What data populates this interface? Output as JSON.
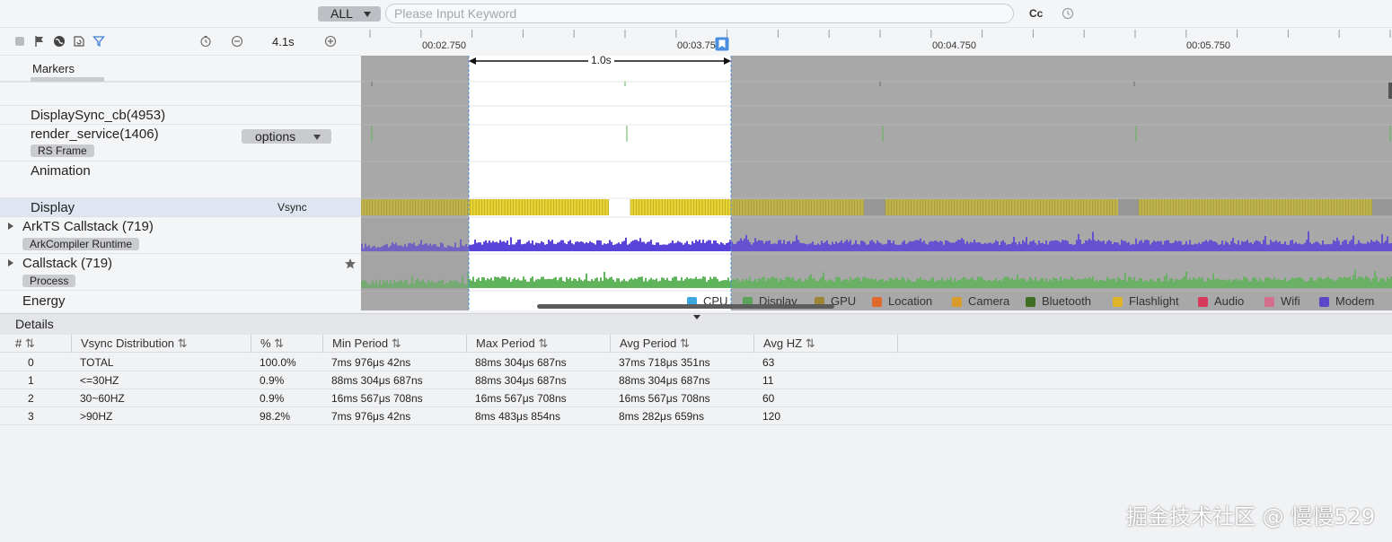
{
  "search": {
    "filter_value": "ALL",
    "placeholder": "Please Input Keyword",
    "case_label": "Cc"
  },
  "toolbar": {
    "zoom_value": "4.1s"
  },
  "ruler": {
    "ticks": [
      "00:02.750",
      "00:03.750",
      "00:04.750",
      "00:05.750"
    ],
    "selection_duration": "1.0s"
  },
  "rows": {
    "markers": "Markers",
    "displaysync": "DisplaySync_cb(4953)",
    "render_service": "render_service(1406)",
    "render_badge": "RS Frame",
    "options_label": "options",
    "animation": "Animation",
    "display": "Display",
    "display_tag": "Vsync",
    "arkts": "ArkTS Callstack (719)",
    "arkts_badge": "ArkCompiler Runtime",
    "callstack": "Callstack (719)",
    "callstack_badge": "Process",
    "energy": "Energy"
  },
  "energy_legend": [
    {
      "label": "CPU",
      "color": "#3fa7e0"
    },
    {
      "label": "Display",
      "color": "#5ba35b"
    },
    {
      "label": "GPU",
      "color": "#9c8535"
    },
    {
      "label": "Location",
      "color": "#e06a2c"
    },
    {
      "label": "Camera",
      "color": "#d99b2a"
    },
    {
      "label": "Bluetooth",
      "color": "#3f6d23"
    },
    {
      "label": "Flashlight",
      "color": "#e0b428"
    },
    {
      "label": "Audio",
      "color": "#d6395b"
    },
    {
      "label": "Wifi",
      "color": "#d36e8c"
    },
    {
      "label": "Modem",
      "color": "#5a48c9"
    }
  ],
  "colors": {
    "vsync_yellow": "#e8d432",
    "arkts_purple": "#5a43d8",
    "callstack_green": "#5fb35a",
    "selection_blue": "#4a8fe0"
  },
  "details": {
    "title": "Details",
    "columns": [
      "#",
      "Vsync Distribution",
      "%",
      "Min Period",
      "Max Period",
      "Avg Period",
      "Avg HZ"
    ],
    "rows": [
      [
        "0",
        "TOTAL",
        "100.0%",
        "7ms 976μs 42ns",
        "88ms 304μs 687ns",
        "37ms 718μs 351ns",
        "63"
      ],
      [
        "1",
        "<=30HZ",
        "0.9%",
        "88ms 304μs 687ns",
        "88ms 304μs 687ns",
        "88ms 304μs 687ns",
        "11"
      ],
      [
        "2",
        "30~60HZ",
        "0.9%",
        "16ms 567μs 708ns",
        "16ms 567μs 708ns",
        "16ms 567μs 708ns",
        "60"
      ],
      [
        "3",
        ">90HZ",
        "98.2%",
        "7ms 976μs 42ns",
        "8ms 483μs 854ns",
        "8ms 282μs 659ns",
        "120"
      ]
    ]
  },
  "watermark": "掘金技术社区 @ 慢慢529"
}
